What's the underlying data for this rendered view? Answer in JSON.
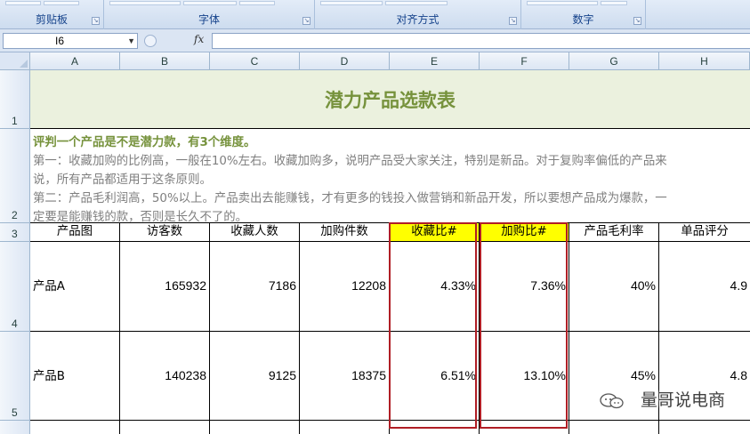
{
  "ribbon": {
    "groups": [
      {
        "label": "剪贴板"
      },
      {
        "label": "字体"
      },
      {
        "label": "对齐方式"
      },
      {
        "label": "数字"
      }
    ]
  },
  "formula_bar": {
    "name_box": "I6",
    "fx_label": "fx",
    "formula": ""
  },
  "columns": [
    "A",
    "B",
    "C",
    "D",
    "E",
    "F",
    "G",
    "H"
  ],
  "rows": [
    "1",
    "2",
    "3",
    "4",
    "5"
  ],
  "sheet": {
    "title": "潜力产品选款表",
    "description": {
      "heading": "评判一个产品是不是潜力款，有3个维度。",
      "line1": "第一：收藏加购的比例高，一般在10%左右。收藏加购多，说明产品受大家关注，特别是新品。对于复购率偏低的产品来",
      "line2": "说，所有产品都适用于这条原则。",
      "line3": "第二：产品毛利润高，50%以上。产品卖出去能赚钱，才有更多的钱投入做营销和新品开发，所以要想产品成为爆款，一",
      "line4": "定要是能赚钱的款，否则是长久不了的。"
    },
    "headers": [
      "产品图",
      "访客数",
      "收藏人数",
      "加购件数",
      "收藏比#",
      "加购比#",
      "产品毛利率",
      "单品评分"
    ],
    "data_rows": [
      {
        "product": "产品A",
        "visitors": "165932",
        "favorites": "7186",
        "add_to_cart": "12208",
        "favorite_ratio": "4.33%",
        "cart_ratio": "7.36%",
        "gross_margin": "40%",
        "rating": "4.9"
      },
      {
        "product": "产品B",
        "visitors": "140238",
        "favorites": "9125",
        "add_to_cart": "18375",
        "favorite_ratio": "6.51%",
        "cart_ratio": "13.10%",
        "gross_margin": "45%",
        "rating": "4.8"
      }
    ]
  },
  "watermark": "量哥说电商",
  "colors": {
    "title_text": "#76923c",
    "title_fill": "#ebf1de",
    "header_highlight": "#ffff00",
    "border_highlight": "#b01e25",
    "description_text": "#7f7f7f"
  }
}
